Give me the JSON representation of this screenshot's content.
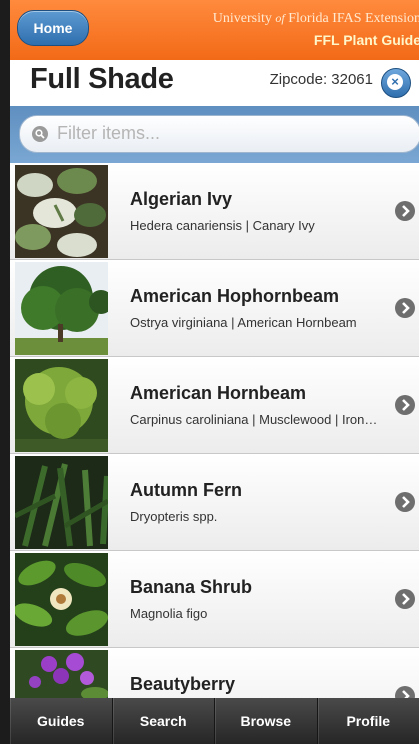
{
  "header": {
    "home_label": "Home",
    "brand_part1": "University",
    "brand_of": "of",
    "brand_part2": "Florida  IFAS Extension",
    "brand_line2": "FFL Plant Guide"
  },
  "titlebar": {
    "title": "Full Shade",
    "zip_label": "Zipcode: 32061",
    "zip_icon": "clear-circle-icon"
  },
  "filter": {
    "placeholder": "Filter items...",
    "icon": "search-icon"
  },
  "items": [
    {
      "name": "Algerian Ivy",
      "sub": "Hedera canariensis | Canary Ivy"
    },
    {
      "name": "American Hophornbeam",
      "sub": "Ostrya virginiana | American Hornbeam"
    },
    {
      "name": "American Hornbeam",
      "sub": "Carpinus caroliniana | Musclewood | Ironwood"
    },
    {
      "name": "Autumn Fern",
      "sub": "Dryopteris spp."
    },
    {
      "name": "Banana Shrub",
      "sub": "Magnolia figo"
    },
    {
      "name": "Beautyberry",
      "sub": ""
    }
  ],
  "footer": {
    "tabs": [
      "Guides",
      "Search",
      "Browse",
      "Profile"
    ]
  },
  "colors": {
    "header_orange": "#f26a17",
    "button_blue": "#2f6fae",
    "filter_bar_blue": "#6b9ac9"
  }
}
